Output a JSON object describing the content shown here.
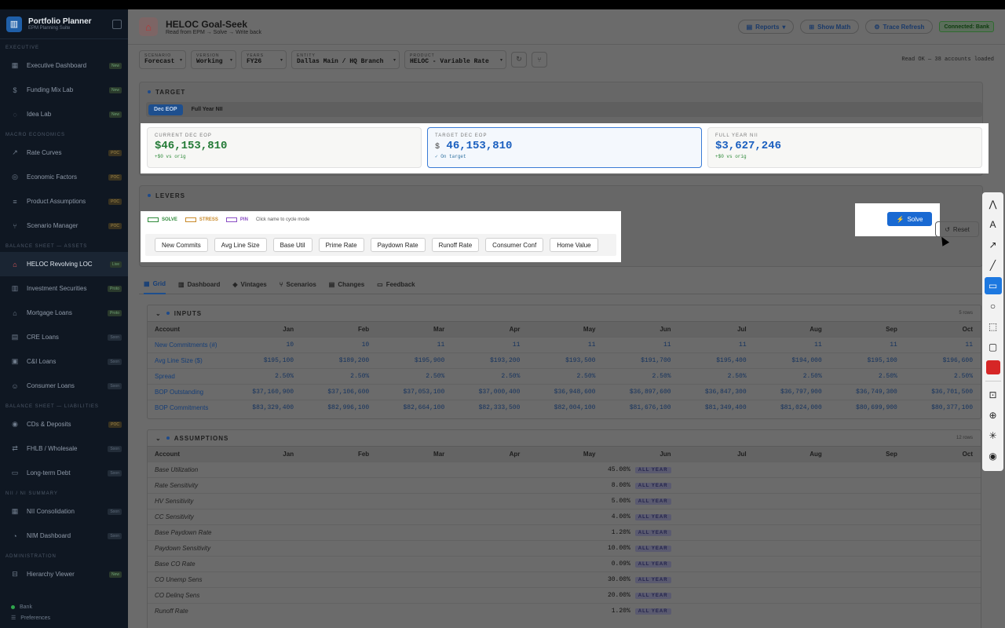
{
  "brand": {
    "title": "Portfolio Planner",
    "subtitle": "EPM Planning Suite"
  },
  "sidebar": {
    "sections": [
      {
        "label": "EXECUTIVE",
        "items": [
          {
            "label": "Executive Dashboard",
            "badge": "New",
            "icon": "grid-icon"
          },
          {
            "label": "Funding Mix Lab",
            "badge": "New",
            "icon": "dollar-icon"
          },
          {
            "label": "Idea Lab",
            "badge": "New",
            "icon": "bulb-icon"
          }
        ]
      },
      {
        "label": "MACRO ECONOMICS",
        "items": [
          {
            "label": "Rate Curves",
            "badge": "POC",
            "icon": "trend-icon"
          },
          {
            "label": "Economic Factors",
            "badge": "POC",
            "icon": "globe-icon"
          },
          {
            "label": "Product Assumptions",
            "badge": "POC",
            "icon": "sliders-icon"
          },
          {
            "label": "Scenario Manager",
            "badge": "POC",
            "icon": "branch-icon"
          }
        ]
      },
      {
        "label": "BALANCE SHEET — ASSETS",
        "items": [
          {
            "label": "HELOC Revolving LOC",
            "badge": "Live",
            "icon": "home-icon",
            "active": true
          },
          {
            "label": "Investment Securities",
            "badge": "Proto",
            "icon": "chart-icon"
          },
          {
            "label": "Mortgage Loans",
            "badge": "Proto",
            "icon": "house-icon"
          },
          {
            "label": "CRE Loans",
            "badge": "Soon",
            "icon": "building-icon"
          },
          {
            "label": "C&I Loans",
            "badge": "Soon",
            "icon": "briefcase-icon"
          },
          {
            "label": "Consumer Loans",
            "badge": "Soon",
            "icon": "users-icon"
          }
        ]
      },
      {
        "label": "BALANCE SHEET — LIABILITIES",
        "items": [
          {
            "label": "CDs & Deposits",
            "badge": "POC",
            "icon": "coin-icon"
          },
          {
            "label": "FHLB / Wholesale",
            "badge": "Soon",
            "icon": "swap-icon"
          },
          {
            "label": "Long-term Debt",
            "badge": "Soon",
            "icon": "doc-icon"
          }
        ]
      },
      {
        "label": "NII / NI SUMMARY",
        "items": [
          {
            "label": "NII Consolidation",
            "badge": "Soon",
            "icon": "table-icon"
          },
          {
            "label": "NIM Dashboard",
            "badge": "Soon",
            "icon": "gauge-icon"
          }
        ]
      },
      {
        "label": "ADMINISTRATION",
        "items": [
          {
            "label": "Hierarchy Viewer",
            "badge": "New",
            "icon": "tree-icon"
          }
        ]
      }
    ],
    "footer": {
      "bank": "Bank",
      "preferences": "Preferences"
    }
  },
  "header": {
    "title": "HELOC Goal-Seek",
    "subtitle": "Read from EPM → Solve → Write back",
    "reports": "Reports",
    "show_math": "Show Math",
    "trace_refresh": "Trace Refresh",
    "connected": "Connected: Bank"
  },
  "filters": [
    {
      "key": "SCENARIO",
      "value": "Forecast"
    },
    {
      "key": "VERSION",
      "value": "Working"
    },
    {
      "key": "YEARS",
      "value": "FY26"
    },
    {
      "key": "ENTITY",
      "value": "Dallas Main / HQ Branch"
    },
    {
      "key": "PRODUCT",
      "value": "HELOC - Variable Rate"
    }
  ],
  "read_status": "Read OK — 38 accounts loaded",
  "target": {
    "title": "TARGET",
    "toggle": [
      "Dec EOP",
      "Full Year NII"
    ],
    "cards": [
      {
        "key": "CURRENT DEC EOP",
        "value": "$46,153,810",
        "delta": "+$0 vs orig"
      },
      {
        "key": "TARGET DEC EOP",
        "prefix": "$",
        "value": "46,153,810",
        "delta": "✓ On target"
      },
      {
        "key": "FULL YEAR NII",
        "value": "$3,627,246",
        "delta": "+$0 vs orig"
      }
    ]
  },
  "levers": {
    "title": "LEVERS",
    "legend": [
      {
        "label": "SOLVE",
        "color": "#2f8a3a"
      },
      {
        "label": "STRESS",
        "color": "#c98a2a"
      },
      {
        "label": "PIN",
        "color": "#8a4fc4"
      }
    ],
    "hint": "Click name to cycle mode",
    "items": [
      "New Commits",
      "Avg Line Size",
      "Base Util",
      "Prime Rate",
      "Paydown Rate",
      "Runoff Rate",
      "Consumer Conf",
      "Home Value"
    ],
    "solve": "Solve",
    "reset": "Reset"
  },
  "tabs": [
    "Grid",
    "Dashboard",
    "Vintages",
    "Scenarios",
    "Changes",
    "Feedback"
  ],
  "inputs": {
    "title": "INPUTS",
    "row_count": "5 rows",
    "columns": [
      "Account",
      "Jan",
      "Feb",
      "Mar",
      "Apr",
      "May",
      "Jun",
      "Jul",
      "Aug",
      "Sep",
      "Oct"
    ],
    "rows": [
      [
        "New Commitments (#)",
        "10",
        "10",
        "11",
        "11",
        "11",
        "11",
        "11",
        "11",
        "11",
        "11"
      ],
      [
        "Avg Line Size ($)",
        "$195,100",
        "$189,200",
        "$195,900",
        "$193,200",
        "$193,500",
        "$191,700",
        "$195,400",
        "$194,000",
        "$195,100",
        "$196,600"
      ],
      [
        "Spread",
        "2.50%",
        "2.50%",
        "2.50%",
        "2.50%",
        "2.50%",
        "2.50%",
        "2.50%",
        "2.50%",
        "2.50%",
        "2.50%"
      ],
      [
        "BOP Outstanding",
        "$37,160,900",
        "$37,106,600",
        "$37,053,100",
        "$37,000,400",
        "$36,948,600",
        "$36,897,600",
        "$36,847,300",
        "$36,797,900",
        "$36,749,300",
        "$36,701,500"
      ],
      [
        "BOP Commitments",
        "$83,329,400",
        "$82,996,100",
        "$82,664,100",
        "$82,333,500",
        "$82,004,100",
        "$81,676,100",
        "$81,349,400",
        "$81,024,000",
        "$80,699,900",
        "$80,377,100"
      ]
    ]
  },
  "assumptions": {
    "title": "ASSUMPTIONS",
    "row_count": "12 rows",
    "tag": "ALL YEAR",
    "rows": [
      {
        "name": "Base Utilization",
        "value": "45.00%"
      },
      {
        "name": "Rate Sensitivity",
        "value": "8.00%"
      },
      {
        "name": "HV Sensitivity",
        "value": "5.00%"
      },
      {
        "name": "CC Sensitivity",
        "value": "4.00%"
      },
      {
        "name": "Base Paydown Rate",
        "value": "1.20%"
      },
      {
        "name": "Paydown Sensitivity",
        "value": "10.00%"
      },
      {
        "name": "Base CO Rate",
        "value": "0.09%"
      },
      {
        "name": "CO Unemp Sens",
        "value": "30.00%"
      },
      {
        "name": "CO Delinq Sens",
        "value": "20.00%"
      },
      {
        "name": "Runoff Rate",
        "value": "1.20%"
      }
    ]
  },
  "toolbar": [
    "pen-icon",
    "text-icon",
    "arrow-icon",
    "line-icon",
    "rectangle-icon",
    "circle-icon",
    "select-icon",
    "callout-icon",
    "color-icon",
    "capture-icon",
    "zoom-icon",
    "spotlight-icon",
    "record-icon"
  ]
}
